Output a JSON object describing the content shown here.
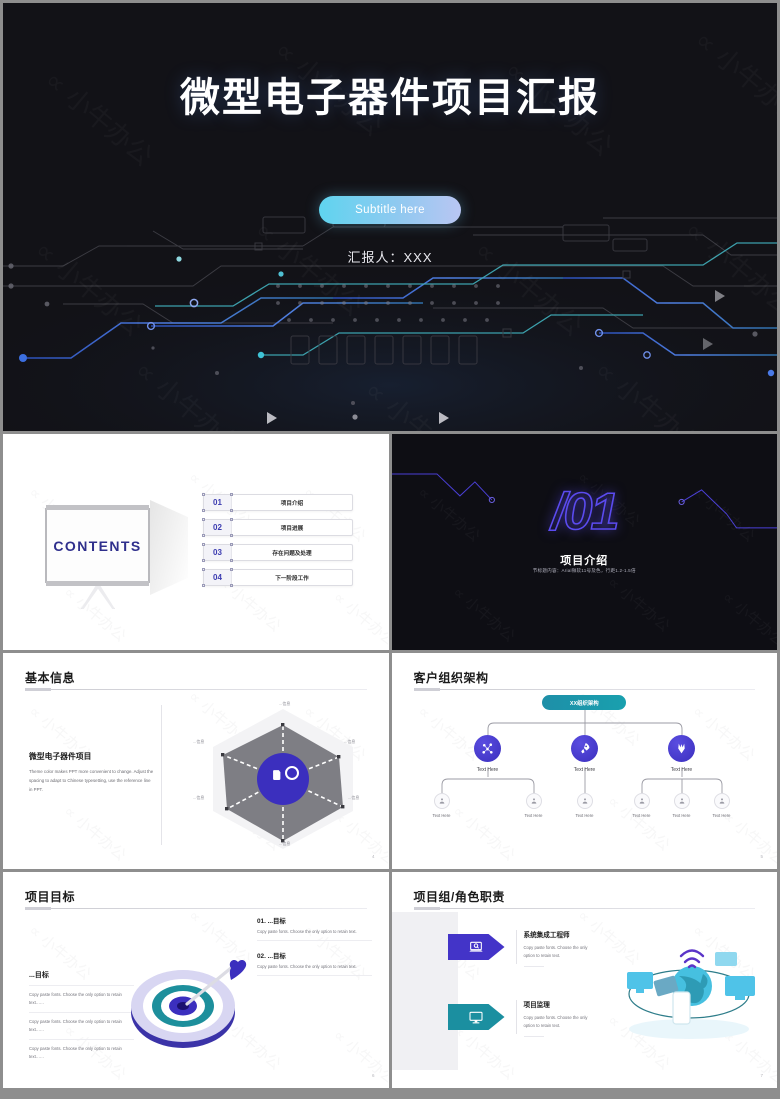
{
  "cover": {
    "title": "微型电子器件项目汇报",
    "subtitle_pill": "Subtitle here",
    "presenter": "汇报人：XXX"
  },
  "contents": {
    "heading": "CONTENTS",
    "items": [
      {
        "num": "01",
        "label": "项目介绍"
      },
      {
        "num": "02",
        "label": "项目进展"
      },
      {
        "num": "03",
        "label": "存在问题及处理"
      },
      {
        "num": "04",
        "label": "下一阶段工作"
      }
    ]
  },
  "section01": {
    "number": "/01",
    "title": "项目介绍",
    "subtitle": "节标题内容：Arial微软11号及色，行距1.2-1.5倍"
  },
  "basic_info": {
    "title": "基本信息",
    "lead": "微型电子器件项目",
    "body": "Theme color makes PPT more convenient to change. Adjust the spacing to adapt to Chinese typesetting, use the reference line in PPT.",
    "radar_labels": [
      "...信息",
      "...信息",
      "...信息",
      "...信息",
      "...信息",
      "...信息"
    ],
    "page": "4"
  },
  "org_chart": {
    "title": "客户组织架构",
    "root": "XX组织架构",
    "level1": [
      "Text Here",
      "Text Here",
      "Text Here"
    ],
    "level2": [
      "Text Here",
      "Text Here",
      "Text Here",
      "Text Here",
      "Text Here",
      "Text Here"
    ],
    "page": "5"
  },
  "goals": {
    "title": "项目目标",
    "left_heading": "...目标",
    "left_items": [
      "Copy paste fonts. Choose the only option to retain text……",
      "Copy paste fonts. Choose the only option to retain text……",
      "Copy paste fonts. Choose the only option to retain text……"
    ],
    "right_items": [
      {
        "heading": "01. ...目标",
        "body": "Copy paste fonts. Choose the only option to retain text."
      },
      {
        "heading": "02. ...目标",
        "body": "Copy paste fonts. Choose the only option to retain text."
      }
    ],
    "page": "6"
  },
  "roles": {
    "title": "项目组/角色职责",
    "items": [
      {
        "heading": "系统集成工程师",
        "body": "Copy paste fonts. Choose the only option to retain text."
      },
      {
        "heading": "项目监理",
        "body": "Copy paste fonts. Choose the only option to retain text."
      }
    ],
    "page": "7"
  },
  "watermark": "小牛办公",
  "colors": {
    "cover_bg": "#121217",
    "accent_purple": "#3b2fbe",
    "accent_teal": "#1b8fa0",
    "neon_blue": "#5b4bf0",
    "pill_from": "#5fd4ef",
    "pill_to": "#b9c6f3"
  }
}
